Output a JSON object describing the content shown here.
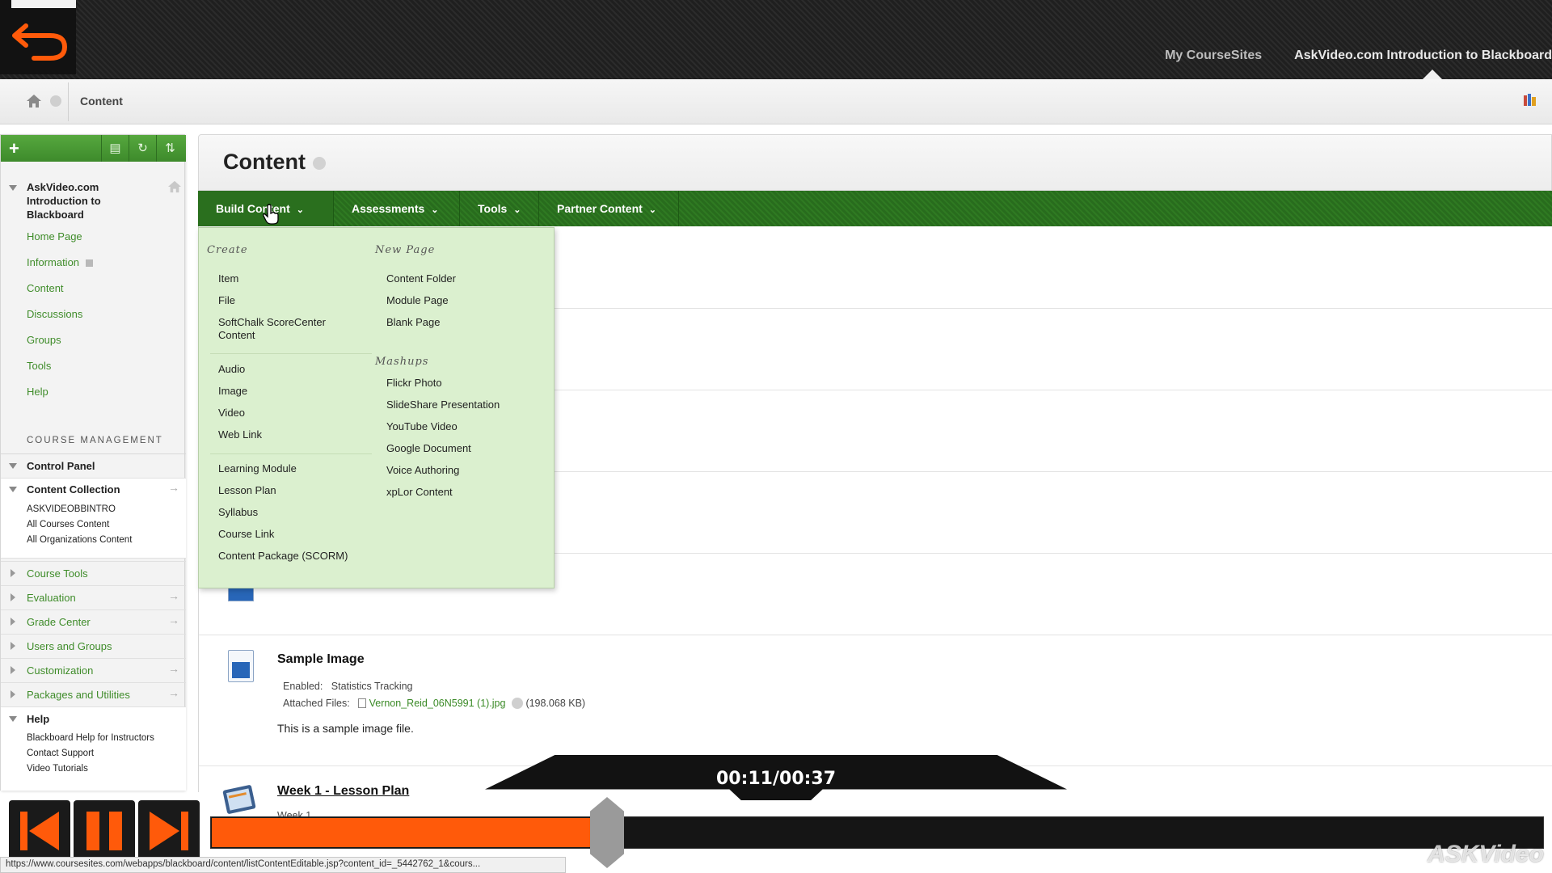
{
  "topnav": {
    "my_coursesites": "My CourseSites",
    "course_link": "AskVideo.com Introduction to Blackboard"
  },
  "breadcrumb": {
    "current": "Content"
  },
  "sidebar": {
    "course_title": "AskVideo.com Introduction to Blackboard",
    "menu": [
      "Home Page",
      "Information",
      "Content",
      "Discussions",
      "Groups",
      "Tools",
      "Help"
    ],
    "section_label": "COURSE MANAGEMENT",
    "control_panel": "Control Panel",
    "content_collection": "Content Collection",
    "content_collection_items": [
      "ASKVIDEOBBINTRO",
      "All Courses Content",
      "All Organizations Content"
    ],
    "management_items": [
      "Course Tools",
      "Evaluation",
      "Grade Center",
      "Users and Groups",
      "Customization",
      "Packages and Utilities"
    ],
    "help_label": "Help",
    "help_items": [
      "Blackboard Help for Instructors",
      "Contact Support",
      "Video Tutorials"
    ]
  },
  "page": {
    "title": "Content",
    "actions": [
      "Build Content",
      "Assessments",
      "Tools",
      "Partner Content"
    ]
  },
  "build_menu": {
    "create_header": "Create",
    "create_items_1": [
      "Item",
      "File",
      "SoftChalk ScoreCenter",
      "Content"
    ],
    "create_items_2": [
      "Audio",
      "Image",
      "Video",
      "Web Link"
    ],
    "create_items_3": [
      "Learning Module",
      "Lesson Plan",
      "Syllabus",
      "Course Link",
      "Content Package (SCORM)"
    ],
    "newpage_header": "New Page",
    "newpage_items": [
      "Content Folder",
      "Module Page",
      "Blank Page"
    ],
    "mashups_header": "Mashups",
    "mashups_items": [
      "Flickr Photo",
      "SlideShare Presentation",
      "YouTube Video",
      "Google Document",
      "Voice Authoring",
      "xpLor Content"
    ]
  },
  "items": {
    "sample": {
      "title": "Sample Image",
      "enabled_label": "Enabled:",
      "enabled_value": "Statistics Tracking",
      "attached_label": "Attached Files:",
      "file_name": "Vernon_Reid_06N5991 (1).jpg",
      "file_size": "(198.068 KB)",
      "description": "This is a sample image file."
    },
    "week1": {
      "title": "Week 1 - Lesson Plan",
      "subtitle": "Week 1"
    }
  },
  "player": {
    "timecode": "00:11/00:37",
    "progress_fraction": 0.2973,
    "accent": "#ff5a0a",
    "watermark": "ASKVideo"
  },
  "status_url": "https://www.coursesites.com/webapps/blackboard/content/listContentEditable.jsp?content_id=_5442762_1&cours..."
}
